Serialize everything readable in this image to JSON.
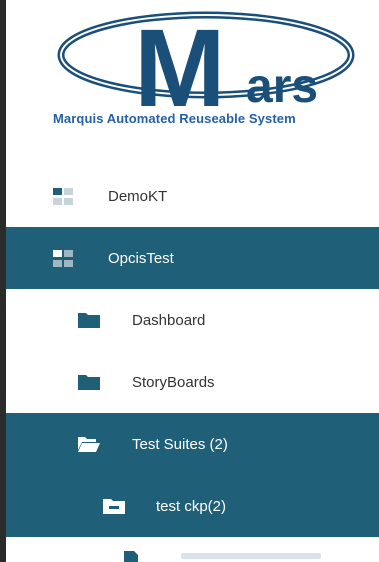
{
  "logo": {
    "text": "ars",
    "letter": "M",
    "tagline": "Marquis Automated Reuseable System"
  },
  "menu": {
    "items": [
      {
        "label": "DemoKT",
        "icon": "grid-icon",
        "level": 1,
        "active": false
      },
      {
        "label": "OpcisTest",
        "icon": "grid-icon",
        "level": 1,
        "active": true
      },
      {
        "label": "Dashboard",
        "icon": "folder-icon",
        "level": 2,
        "active": false
      },
      {
        "label": "StoryBoards",
        "icon": "folder-icon",
        "level": 2,
        "active": false
      },
      {
        "label": "Test Suites (2)",
        "icon": "folder-open-icon",
        "level": 2,
        "active": true
      },
      {
        "label": "test ckp(2)",
        "icon": "folder-minus-icon",
        "level": 3,
        "active": true
      }
    ]
  },
  "colors": {
    "active_bg": "#1f5f78",
    "logo_blue": "#1a4f7a",
    "tagline": "#2560a8"
  }
}
